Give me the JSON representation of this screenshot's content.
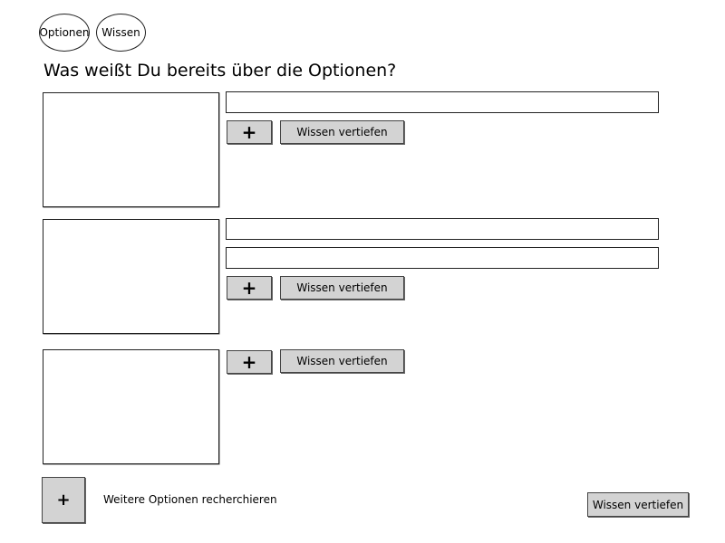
{
  "nav": {
    "optionen_label": "Optionen",
    "wissen_label": "Wissen"
  },
  "page": {
    "title": "Was weißt Du bereits über die Optionen?"
  },
  "options": [
    {
      "fields": [
        ""
      ],
      "plus_label": "+",
      "deepen_label": "Wissen vertiefen"
    },
    {
      "fields": [
        "",
        ""
      ],
      "plus_label": "+",
      "deepen_label": "Wissen vertiefen"
    },
    {
      "fields": [],
      "plus_label": "+",
      "deepen_label": "Wissen vertiefen"
    }
  ],
  "footer": {
    "add_option_label": "+",
    "add_option_text": "Weitere Optionen recherchieren",
    "deepen_label": "Wissen vertiefen"
  }
}
